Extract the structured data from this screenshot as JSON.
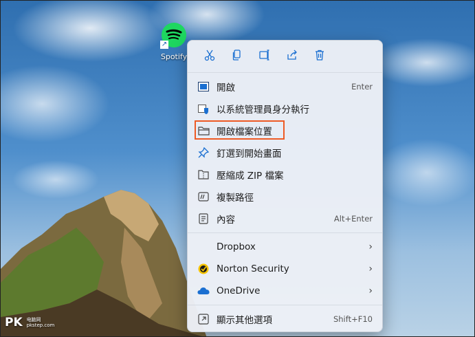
{
  "desktop": {
    "icon_label": "Spotify",
    "watermark_main": "PK",
    "watermark_sub": "电脑网",
    "watermark_site": "pkstep.com"
  },
  "toolbar": {
    "icons": [
      "cut-icon",
      "copy-icon",
      "rename-icon",
      "share-icon",
      "delete-icon"
    ],
    "accent": "#1a6fd1"
  },
  "menu": {
    "items": [
      {
        "label": "開啟",
        "accel": "Enter",
        "icon": "open-icon"
      },
      {
        "label": "以系統管理員身分執行",
        "accel": "",
        "icon": "shield-icon"
      },
      {
        "label": "開啟檔案位置",
        "accel": "",
        "icon": "folder-icon"
      },
      {
        "label": "釘選到開始畫面",
        "accel": "",
        "icon": "pin-icon"
      },
      {
        "label": "壓縮成 ZIP 檔案",
        "accel": "",
        "icon": "zip-icon"
      },
      {
        "label": "複製路徑",
        "accel": "",
        "icon": "copy-path-icon"
      },
      {
        "label": "內容",
        "accel": "Alt+Enter",
        "icon": "properties-icon"
      },
      {
        "label": "Dropbox",
        "accel": "",
        "icon": "none"
      },
      {
        "label": "Norton Security",
        "accel": "",
        "icon": "norton-icon"
      },
      {
        "label": "OneDrive",
        "accel": "",
        "icon": "onedrive-icon"
      },
      {
        "label": "顯示其他選項",
        "accel": "Shift+F10",
        "icon": "more-options-icon"
      }
    ],
    "highlight_color": "#ee5a24"
  }
}
